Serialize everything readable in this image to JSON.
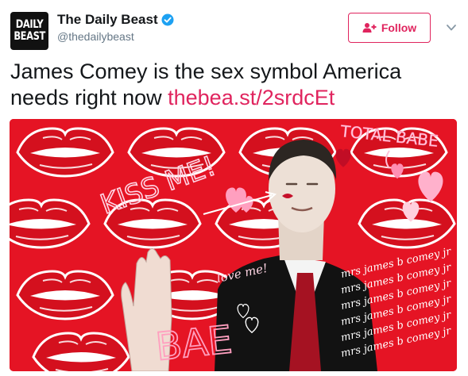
{
  "account": {
    "avatar_line1": "DAILY",
    "avatar_line2": "BEAST",
    "display_name": "The Daily Beast",
    "handle": "@thedailybeast",
    "verified": true
  },
  "follow_button": {
    "label": "Follow",
    "icon": "add-user-icon"
  },
  "menu_icon": "chevron-down-icon",
  "tweet": {
    "text": "James Comey is the sex symbol America needs right now ",
    "link": "thebea.st/2srdcEt"
  },
  "image": {
    "labels": {
      "kiss_me": "KISS ME!",
      "total_babe": "TOTAL BABE",
      "love_me": "love me!",
      "bae": "BAE",
      "signature": "mrs james b comey jr"
    }
  },
  "colors": {
    "accent": "#e0245e",
    "image_background": "#e51424",
    "verified_blue": "#1da1f2"
  }
}
